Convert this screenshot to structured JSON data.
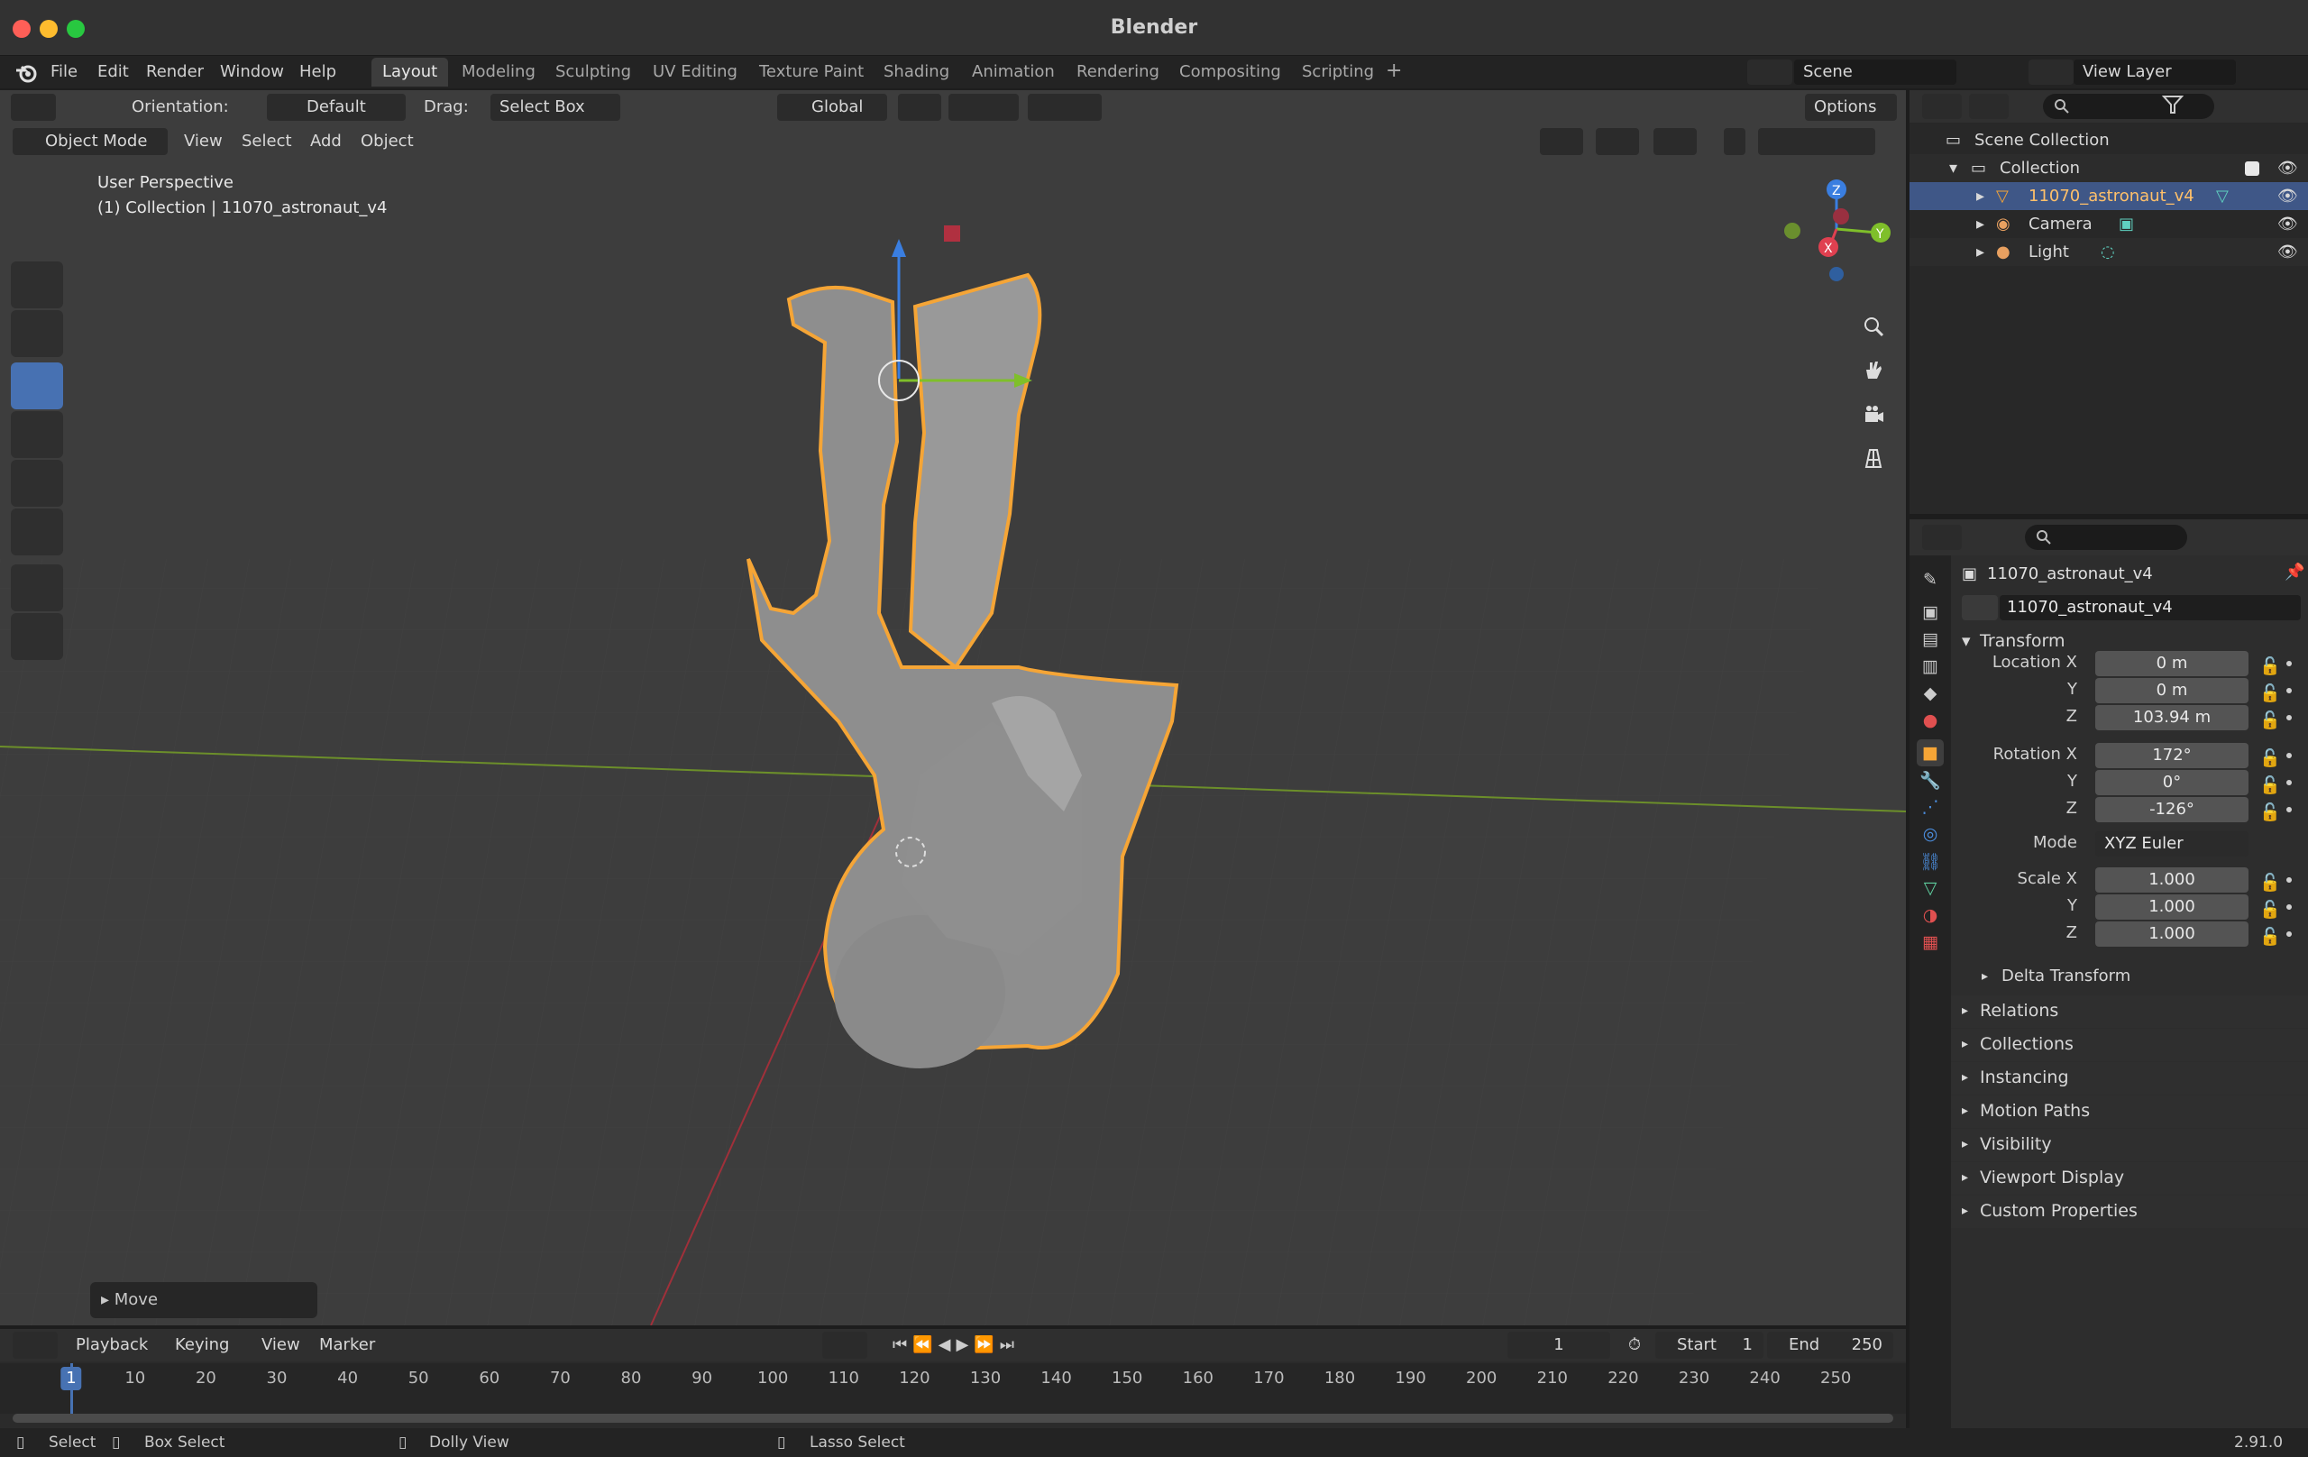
{
  "window": {
    "title": "Blender"
  },
  "menu": [
    "File",
    "Edit",
    "Render",
    "Window",
    "Help"
  ],
  "workspaces": [
    "Layout",
    "Modeling",
    "Sculpting",
    "UV Editing",
    "Texture Paint",
    "Shading",
    "Animation",
    "Rendering",
    "Compositing",
    "Scripting"
  ],
  "active_workspace": "Layout",
  "scene": {
    "name": "Scene",
    "view_layer": "View Layer"
  },
  "viewport_header": {
    "orientation_label": "Orientation:",
    "orientation_value": "Default",
    "drag_label": "Drag:",
    "drag_value": "Select Box",
    "transform_orientation": "Global",
    "options": "Options",
    "mode": "Object Mode",
    "view": "View",
    "select": "Select",
    "add": "Add",
    "object": "Object"
  },
  "viewport": {
    "perspective": "User Perspective",
    "collection_info": "(1) Collection | 11070_astronaut_v4",
    "last_op": "Move",
    "gizmo_axes": [
      "Z",
      "Y",
      "X"
    ]
  },
  "outliner": {
    "scene_collection": "Scene Collection",
    "collection": "Collection",
    "items": [
      "11070_astronaut_v4",
      "Camera",
      "Light"
    ]
  },
  "properties": {
    "object_name": "11070_astronaut_v4",
    "data_name": "11070_astronaut_v4",
    "transform_label": "Transform",
    "location_label": "Location X",
    "rotation_label": "Rotation X",
    "scale_label": "Scale X",
    "mode_label": "Mode",
    "axis_y": "Y",
    "axis_z": "Z",
    "location": [
      "0 m",
      "0 m",
      "103.94 m"
    ],
    "rotation": [
      "172°",
      "0°",
      "-126°"
    ],
    "rotation_mode": "XYZ Euler",
    "scale": [
      "1.000",
      "1.000",
      "1.000"
    ],
    "delta_transform": "Delta Transform",
    "sections": [
      "Relations",
      "Collections",
      "Instancing",
      "Motion Paths",
      "Visibility",
      "Viewport Display",
      "Custom Properties"
    ]
  },
  "timeline": {
    "playback": "Playback",
    "keying": "Keying",
    "view": "View",
    "marker": "Marker",
    "current_frame": "1",
    "start_label": "Start",
    "start": "1",
    "end_label": "End",
    "end": "250",
    "ticks": [
      "10",
      "20",
      "30",
      "40",
      "50",
      "60",
      "70",
      "80",
      "90",
      "100",
      "110",
      "120",
      "130",
      "140",
      "150",
      "160",
      "170",
      "180",
      "190",
      "200",
      "210",
      "220",
      "230",
      "240",
      "250"
    ]
  },
  "status": {
    "select": "Select",
    "box_select": "Box Select",
    "dolly_view": "Dolly View",
    "lasso_select": "Lasso Select",
    "version": "2.91.0"
  },
  "colors": {
    "selection_outline": "#f5a536",
    "active_blue": "#4772b3",
    "axis_x": "#e04050",
    "axis_y": "#7fbf2a",
    "axis_z": "#3a7ee0"
  }
}
